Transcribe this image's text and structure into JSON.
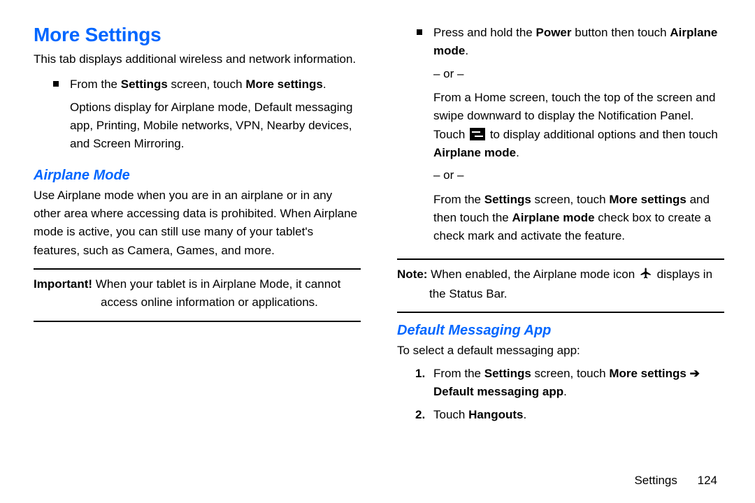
{
  "left": {
    "h1": "More Settings",
    "intro": "This tab displays additional wireless and network information.",
    "bullet_line": "From the <b>Settings</b> screen, touch <b>More settings</b>.",
    "bullet_sub": "Options display for Airplane mode, Default messaging app, Printing, Mobile networks, VPN, Nearby devices, and Screen Mirroring.",
    "airplane_h": "Airplane Mode",
    "airplane_p": "Use Airplane mode when you are in an airplane or in any other area where accessing data is prohibited. When Airplane mode is active, you can still use many of your tablet's features, such as Camera, Games, and more.",
    "important_label": "Important!",
    "important_body_line1": " When your tablet is in Airplane Mode, it cannot",
    "important_body_line2": "access online information or applications."
  },
  "right": {
    "li1": "Press and hold the <b>Power</b> button then touch <b>Airplane mode</b>.",
    "or": "– or –",
    "p2a": "From a Home screen, touch the top of the screen and swipe downward to display the Notification Panel. Touch ",
    "p2b": " to display additional options and then touch <b>Airplane mode</b>.",
    "p3": "From the <b>Settings</b> screen, touch <b>More settings</b> and then touch the <b>Airplane mode</b> check box to create a check mark and activate the feature.",
    "note_label": "Note:",
    "note_body_a": " When enabled, the Airplane mode icon ",
    "note_body_b": " displays in",
    "note_body_c": "the Status Bar.",
    "dma_h": "Default Messaging App",
    "dma_intro": "To select a default messaging app:",
    "step1": "From the <b>Settings</b> screen, touch <b>More settings ➔ Default messaging app</b>.",
    "step2": "Touch <b>Hangouts</b>."
  },
  "footer": {
    "section": "Settings",
    "page": "124"
  },
  "icons": {
    "quick_settings": "quick-settings-icon",
    "airplane": "airplane-icon"
  }
}
